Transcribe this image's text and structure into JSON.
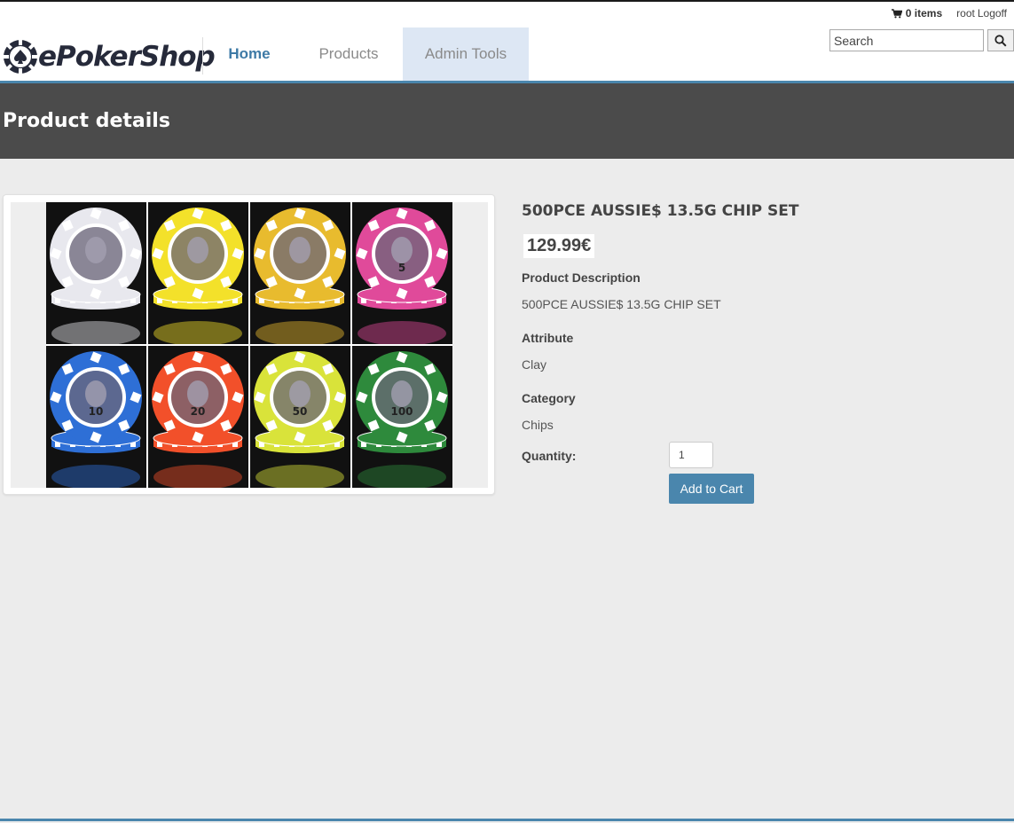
{
  "header": {
    "logo_text": "ePokerShop",
    "cart_label": "0 items",
    "user": "root",
    "logoff_label": "Logoff",
    "search_placeholder": "Search",
    "nav": [
      {
        "label": "Home"
      },
      {
        "label": "Products"
      },
      {
        "label": "Admin Tools"
      }
    ]
  },
  "page": {
    "title": "Product details"
  },
  "product": {
    "name": "500PCE AUSSIE$ 13.5G CHIP SET",
    "price": "129.99€",
    "description_label": "Product Description",
    "description": "500PCE AUSSIE$ 13.5G CHIP SET",
    "attribute_label": "Attribute",
    "attribute": "Clay",
    "category_label": "Category",
    "category": "Chips",
    "quantity_label": "Quantity:",
    "quantity_value": "1",
    "add_to_cart_label": "Add to Cart",
    "chips": [
      {
        "color": "#e8e8ee",
        "rim": "#ffffff",
        "denom": ""
      },
      {
        "color": "#f3e12a",
        "rim": "#ffffff",
        "denom": ""
      },
      {
        "color": "#e8bb2e",
        "rim": "#ffffff",
        "denom": ""
      },
      {
        "color": "#e04a9a",
        "rim": "#ffffff",
        "denom": "5"
      },
      {
        "color": "#2e6fd6",
        "rim": "#ffffff",
        "denom": "10"
      },
      {
        "color": "#f2502a",
        "rim": "#ffffff",
        "denom": "20"
      },
      {
        "color": "#d9e33a",
        "rim": "#ffffff",
        "denom": "50"
      },
      {
        "color": "#2e8a3c",
        "rim": "#ffffff",
        "denom": "100"
      }
    ]
  },
  "colors": {
    "accent": "#4a86ad",
    "banner": "#4b4b4b",
    "nav_active_bg": "#dde7f4"
  }
}
